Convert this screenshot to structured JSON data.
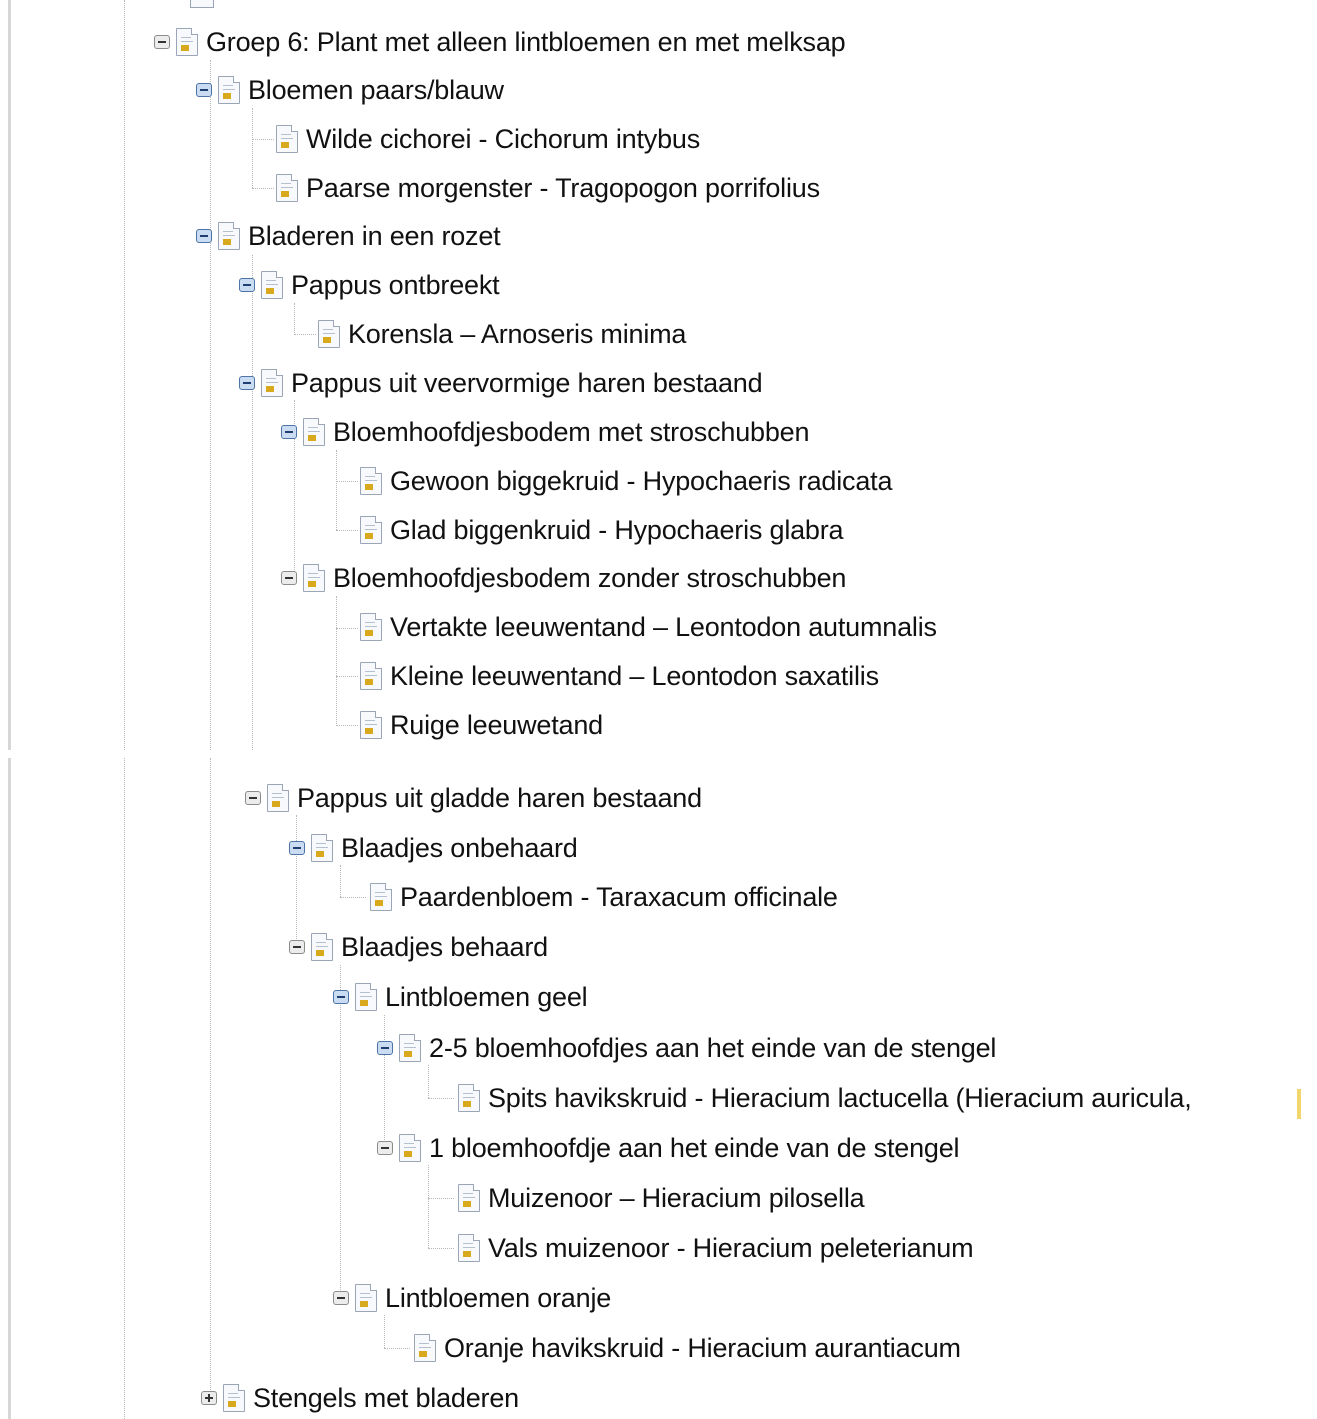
{
  "tree": {
    "nodes": [
      {
        "label": "Groep 6: Plant met alleen lintbloemen en met melksap",
        "toggle": "minus"
      },
      {
        "label": "Bloemen paars/blauw",
        "toggle": "minus"
      },
      {
        "label": "Wilde cichorei - Cichorum intybus",
        "toggle": "none"
      },
      {
        "label": "Paarse morgenster - Tragopogon porrifolius",
        "toggle": "none"
      },
      {
        "label": "Bladeren in een rozet",
        "toggle": "minus"
      },
      {
        "label": "Pappus ontbreekt",
        "toggle": "minus"
      },
      {
        "label": "Korensla – Arnoseris minima",
        "toggle": "none"
      },
      {
        "label": "Pappus uit veervormige haren bestaand",
        "toggle": "minus"
      },
      {
        "label": "Bloemhoofdjesbodem met stroschubben",
        "toggle": "minus"
      },
      {
        "label": "Gewoon biggekruid - Hypochaeris radicata",
        "toggle": "none"
      },
      {
        "label": "Glad biggenkruid - Hypochaeris glabra",
        "toggle": "none"
      },
      {
        "label": "Bloemhoofdjesbodem zonder stroschubben",
        "toggle": "minus"
      },
      {
        "label": "Vertakte leeuwentand – Leontodon autumnalis",
        "toggle": "none"
      },
      {
        "label": "Kleine leeuwentand – Leontodon saxatilis",
        "toggle": "none"
      },
      {
        "label": "Ruige leeuwetand",
        "toggle": "none"
      },
      {
        "label": "Pappus uit gladde haren bestaand",
        "toggle": "minus"
      },
      {
        "label": "Blaadjes onbehaard",
        "toggle": "minus"
      },
      {
        "label": "Paardenbloem - Taraxacum officinale",
        "toggle": "none"
      },
      {
        "label": "Blaadjes behaard",
        "toggle": "minus"
      },
      {
        "label": "Lintbloemen geel",
        "toggle": "minus"
      },
      {
        "label": "2-5 bloemhoofdjes aan het einde van de stengel",
        "toggle": "minus"
      },
      {
        "label": "Spits havikskruid - Hieracium lactucella (Hieracium auricula,",
        "toggle": "none"
      },
      {
        "label": "1 bloemhoofdje aan het einde van de stengel",
        "toggle": "minus"
      },
      {
        "label": "Muizenoor – Hieracium pilosella",
        "toggle": "none"
      },
      {
        "label": "Vals muizenoor - Hieracium peleterianum",
        "toggle": "none"
      },
      {
        "label": "Lintbloemen oranje",
        "toggle": "minus"
      },
      {
        "label": "Oranje havikskruid - Hieracium aurantiacum",
        "toggle": "none"
      },
      {
        "label": "Stengels met bladeren",
        "toggle": "plus"
      }
    ]
  },
  "icons": {
    "toggle_expanded": "minus-box-icon",
    "toggle_collapsed": "plus-box-icon",
    "node": "document-icon"
  }
}
